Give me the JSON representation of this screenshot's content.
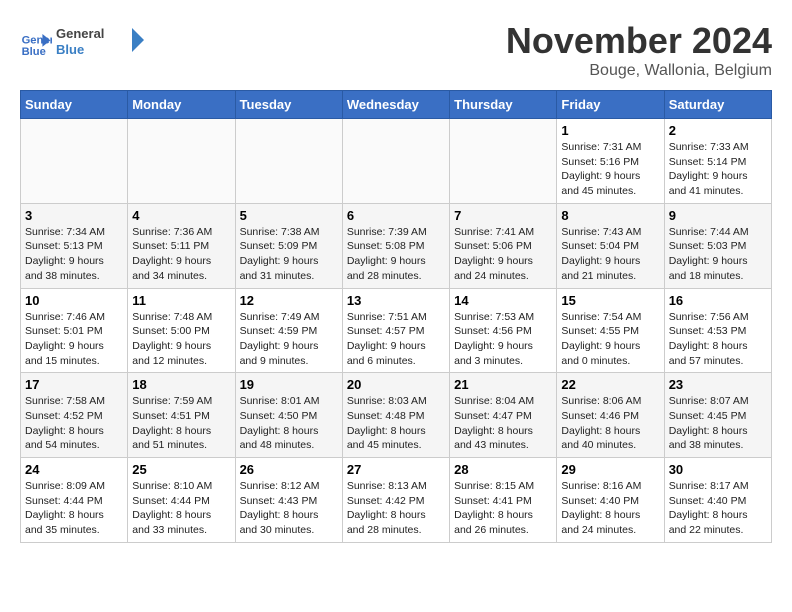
{
  "logo": {
    "line1": "General",
    "line2": "Blue"
  },
  "title": "November 2024",
  "location": "Bouge, Wallonia, Belgium",
  "days_of_week": [
    "Sunday",
    "Monday",
    "Tuesday",
    "Wednesday",
    "Thursday",
    "Friday",
    "Saturday"
  ],
  "weeks": [
    [
      {
        "num": "",
        "empty": true
      },
      {
        "num": "",
        "empty": true
      },
      {
        "num": "",
        "empty": true
      },
      {
        "num": "",
        "empty": true
      },
      {
        "num": "",
        "empty": true
      },
      {
        "num": "1",
        "sunrise": "7:31 AM",
        "sunset": "5:16 PM",
        "daylight": "9 hours and 45 minutes."
      },
      {
        "num": "2",
        "sunrise": "7:33 AM",
        "sunset": "5:14 PM",
        "daylight": "9 hours and 41 minutes."
      }
    ],
    [
      {
        "num": "3",
        "sunrise": "7:34 AM",
        "sunset": "5:13 PM",
        "daylight": "9 hours and 38 minutes."
      },
      {
        "num": "4",
        "sunrise": "7:36 AM",
        "sunset": "5:11 PM",
        "daylight": "9 hours and 34 minutes."
      },
      {
        "num": "5",
        "sunrise": "7:38 AM",
        "sunset": "5:09 PM",
        "daylight": "9 hours and 31 minutes."
      },
      {
        "num": "6",
        "sunrise": "7:39 AM",
        "sunset": "5:08 PM",
        "daylight": "9 hours and 28 minutes."
      },
      {
        "num": "7",
        "sunrise": "7:41 AM",
        "sunset": "5:06 PM",
        "daylight": "9 hours and 24 minutes."
      },
      {
        "num": "8",
        "sunrise": "7:43 AM",
        "sunset": "5:04 PM",
        "daylight": "9 hours and 21 minutes."
      },
      {
        "num": "9",
        "sunrise": "7:44 AM",
        "sunset": "5:03 PM",
        "daylight": "9 hours and 18 minutes."
      }
    ],
    [
      {
        "num": "10",
        "sunrise": "7:46 AM",
        "sunset": "5:01 PM",
        "daylight": "9 hours and 15 minutes."
      },
      {
        "num": "11",
        "sunrise": "7:48 AM",
        "sunset": "5:00 PM",
        "daylight": "9 hours and 12 minutes."
      },
      {
        "num": "12",
        "sunrise": "7:49 AM",
        "sunset": "4:59 PM",
        "daylight": "9 hours and 9 minutes."
      },
      {
        "num": "13",
        "sunrise": "7:51 AM",
        "sunset": "4:57 PM",
        "daylight": "9 hours and 6 minutes."
      },
      {
        "num": "14",
        "sunrise": "7:53 AM",
        "sunset": "4:56 PM",
        "daylight": "9 hours and 3 minutes."
      },
      {
        "num": "15",
        "sunrise": "7:54 AM",
        "sunset": "4:55 PM",
        "daylight": "9 hours and 0 minutes."
      },
      {
        "num": "16",
        "sunrise": "7:56 AM",
        "sunset": "4:53 PM",
        "daylight": "8 hours and 57 minutes."
      }
    ],
    [
      {
        "num": "17",
        "sunrise": "7:58 AM",
        "sunset": "4:52 PM",
        "daylight": "8 hours and 54 minutes."
      },
      {
        "num": "18",
        "sunrise": "7:59 AM",
        "sunset": "4:51 PM",
        "daylight": "8 hours and 51 minutes."
      },
      {
        "num": "19",
        "sunrise": "8:01 AM",
        "sunset": "4:50 PM",
        "daylight": "8 hours and 48 minutes."
      },
      {
        "num": "20",
        "sunrise": "8:03 AM",
        "sunset": "4:48 PM",
        "daylight": "8 hours and 45 minutes."
      },
      {
        "num": "21",
        "sunrise": "8:04 AM",
        "sunset": "4:47 PM",
        "daylight": "8 hours and 43 minutes."
      },
      {
        "num": "22",
        "sunrise": "8:06 AM",
        "sunset": "4:46 PM",
        "daylight": "8 hours and 40 minutes."
      },
      {
        "num": "23",
        "sunrise": "8:07 AM",
        "sunset": "4:45 PM",
        "daylight": "8 hours and 38 minutes."
      }
    ],
    [
      {
        "num": "24",
        "sunrise": "8:09 AM",
        "sunset": "4:44 PM",
        "daylight": "8 hours and 35 minutes."
      },
      {
        "num": "25",
        "sunrise": "8:10 AM",
        "sunset": "4:44 PM",
        "daylight": "8 hours and 33 minutes."
      },
      {
        "num": "26",
        "sunrise": "8:12 AM",
        "sunset": "4:43 PM",
        "daylight": "8 hours and 30 minutes."
      },
      {
        "num": "27",
        "sunrise": "8:13 AM",
        "sunset": "4:42 PM",
        "daylight": "8 hours and 28 minutes."
      },
      {
        "num": "28",
        "sunrise": "8:15 AM",
        "sunset": "4:41 PM",
        "daylight": "8 hours and 26 minutes."
      },
      {
        "num": "29",
        "sunrise": "8:16 AM",
        "sunset": "4:40 PM",
        "daylight": "8 hours and 24 minutes."
      },
      {
        "num": "30",
        "sunrise": "8:17 AM",
        "sunset": "4:40 PM",
        "daylight": "8 hours and 22 minutes."
      }
    ]
  ]
}
